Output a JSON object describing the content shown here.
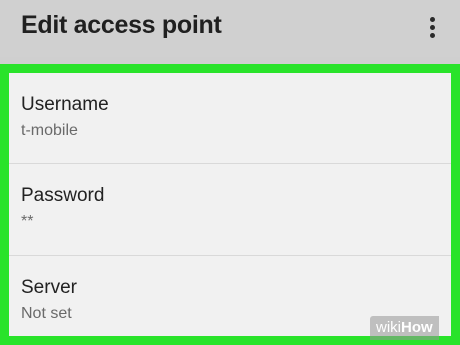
{
  "header": {
    "title": "Edit access point",
    "menu_icon": "more-vert-icon"
  },
  "colors": {
    "header_bg": "#d0d0d0",
    "highlight": "#29e32a",
    "list_bg": "#f1f1f1"
  },
  "settings": [
    {
      "label": "Username",
      "value": "t-mobile"
    },
    {
      "label": "Password",
      "value": "**"
    },
    {
      "label": "Server",
      "value": "Not set"
    }
  ],
  "watermark": {
    "part1": "wiki",
    "part2": "How"
  }
}
